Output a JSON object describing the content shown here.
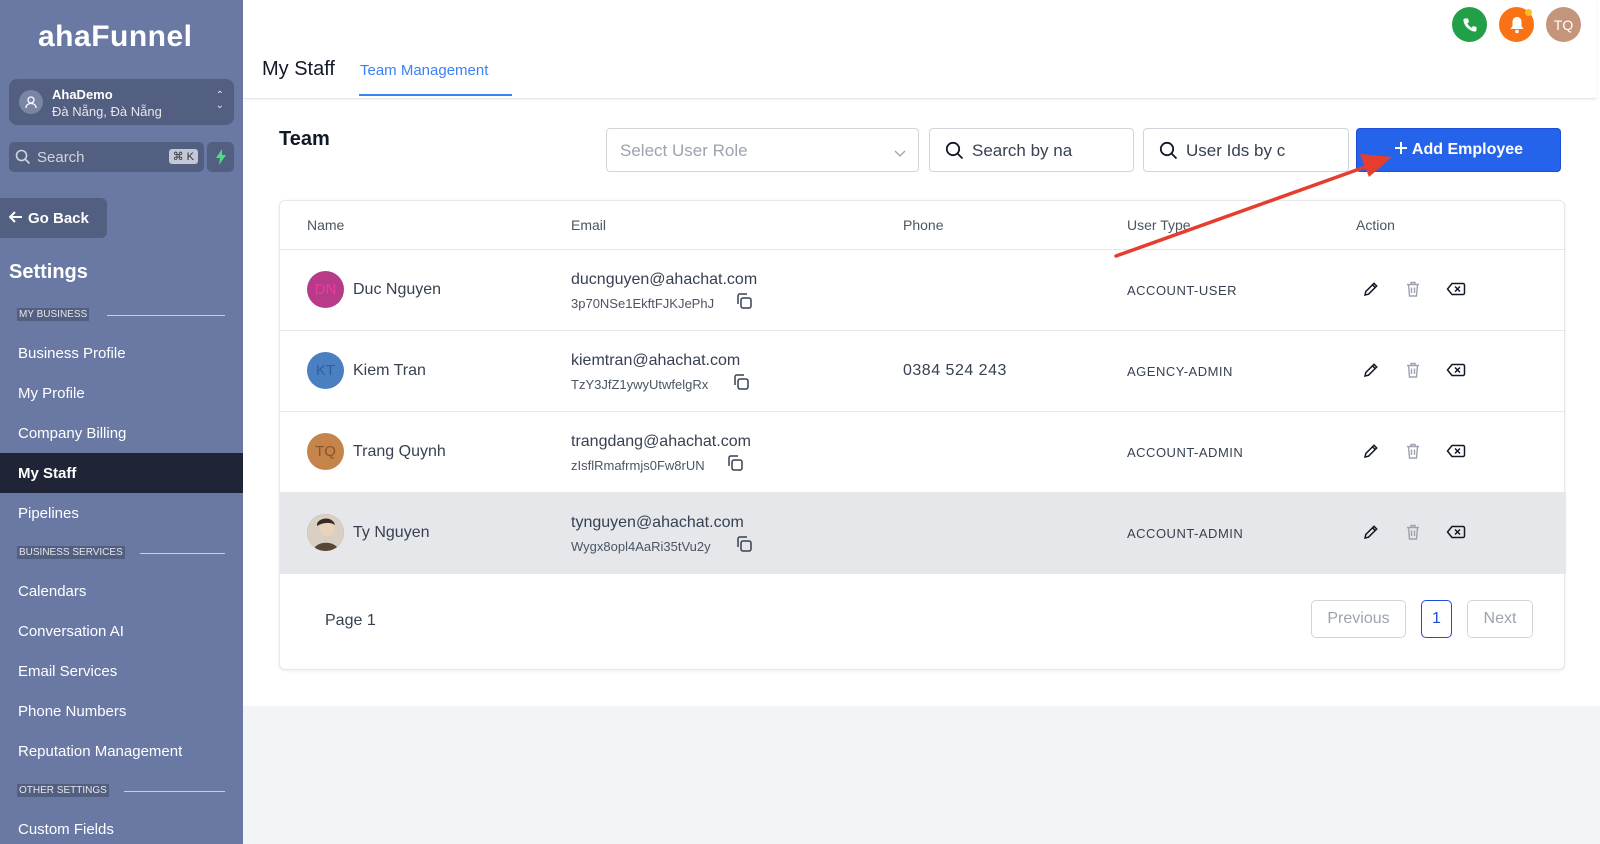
{
  "sidebar": {
    "logo": "ahaFunnel",
    "account": {
      "name": "AhaDemo",
      "location": "Đà Nẵng, Đà Nẵng"
    },
    "search": {
      "placeholder": "Search",
      "shortcut": "⌘ K"
    },
    "go_back": "Go Back",
    "settings_title": "Settings",
    "sections": [
      {
        "label": "MY BUSINESS",
        "items": [
          "Business Profile",
          "My Profile",
          "Company Billing",
          "My Staff",
          "Pipelines"
        ]
      },
      {
        "label": "BUSINESS SERVICES",
        "items": [
          "Calendars",
          "Conversation AI",
          "Email Services",
          "Phone Numbers",
          "Reputation Management"
        ]
      },
      {
        "label": "OTHER SETTINGS",
        "items": [
          "Custom Fields"
        ]
      }
    ],
    "active_item": "My Staff"
  },
  "header": {
    "title": "My Staff",
    "tab": "Team Management",
    "user_initials": "TQ",
    "colors": {
      "phone": "#22a047",
      "bell": "#f97316",
      "avatar": "#c4957a"
    }
  },
  "team": {
    "title": "Team",
    "role_select": {
      "placeholder": "Select User Role"
    },
    "search_name": {
      "value": "Search by na"
    },
    "search_ids": {
      "value": "User Ids by c"
    },
    "add_button": "Add Employee"
  },
  "table": {
    "headers": [
      "Name",
      "Email",
      "Phone",
      "User Type",
      "Action"
    ],
    "rows": [
      {
        "initials": "DN",
        "avatar_color": "#b83b8a",
        "avatar_text_color": "#e83b9e",
        "name": "Duc Nguyen",
        "email": "ducnguyen@ahachat.com",
        "uid": "3p70NSe1EkftFJKJePhJ",
        "phone": "",
        "user_type": "ACCOUNT-USER"
      },
      {
        "initials": "KT",
        "avatar_color": "#4a7fc1",
        "avatar_text_color": "#2f5f9e",
        "name": "Kiem Tran",
        "email": "kiemtran@ahachat.com",
        "uid": "TzY3JfZ1ywyUtwfelgRx",
        "phone": "0384 524 243",
        "user_type": "AGENCY-ADMIN"
      },
      {
        "initials": "TQ",
        "avatar_color": "#c4844a",
        "avatar_text_color": "#8a5526",
        "name": "Trang Quynh",
        "email": "trangdang@ahachat.com",
        "uid": "zIsflRmafrmjs0Fw8rUN",
        "phone": "",
        "user_type": "ACCOUNT-ADMIN"
      },
      {
        "initials": "",
        "avatar_color": "#8a7360",
        "avatar_text_color": "#ffffff",
        "name": "Ty Nguyen",
        "email": "tynguyen@ahachat.com",
        "uid": "Wygx8opl4AaRi35tVu2y",
        "phone": "",
        "user_type": "ACCOUNT-ADMIN"
      }
    ]
  },
  "pagination": {
    "label": "Page 1",
    "previous": "Previous",
    "current": "1",
    "next": "Next"
  }
}
